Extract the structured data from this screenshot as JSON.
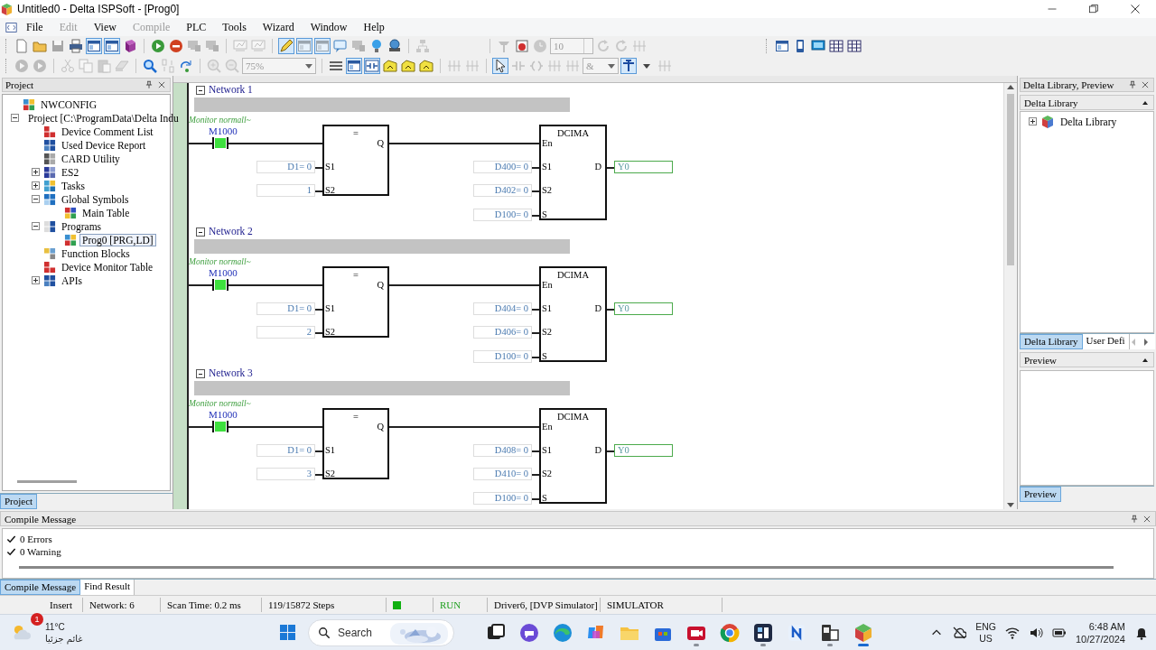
{
  "window": {
    "title": "Untitled0 - Delta ISPSoft - [Prog0]"
  },
  "menu": [
    {
      "label": "File",
      "disabled": false
    },
    {
      "label": "Edit",
      "disabled": true
    },
    {
      "label": "View",
      "disabled": false
    },
    {
      "label": "Compile",
      "disabled": true
    },
    {
      "label": "PLC",
      "disabled": false
    },
    {
      "label": "Tools",
      "disabled": false
    },
    {
      "label": "Wizard",
      "disabled": false
    },
    {
      "label": "Window",
      "disabled": false
    },
    {
      "label": "Help",
      "disabled": false
    }
  ],
  "toolbar_rows": [
    [
      {
        "items": [
          {
            "kind": "button",
            "disabled": false,
            "pressed": false
          },
          {
            "kind": "button",
            "disabled": false,
            "pressed": false
          },
          {
            "kind": "button",
            "disabled": true,
            "pressed": false
          },
          {
            "kind": "button",
            "disabled": false,
            "pressed": false
          },
          {
            "kind": "button",
            "disabled": false,
            "pressed": true
          },
          {
            "kind": "button",
            "disabled": false,
            "pressed": true
          },
          {
            "kind": "button",
            "disabled": false,
            "pressed": false
          },
          {
            "kind": "separator"
          },
          {
            "kind": "button",
            "disabled": false,
            "pressed": false
          },
          {
            "kind": "button",
            "disabled": false,
            "pressed": false
          },
          {
            "kind": "button",
            "disabled": true,
            "pressed": false
          },
          {
            "kind": "button",
            "disabled": true,
            "pressed": false
          },
          {
            "kind": "separator"
          },
          {
            "kind": "button",
            "disabled": true,
            "pressed": false
          },
          {
            "kind": "button",
            "disabled": true,
            "pressed": false
          },
          {
            "kind": "separator"
          },
          {
            "kind": "button",
            "disabled": false,
            "pressed": true
          },
          {
            "kind": "button",
            "disabled": true,
            "pressed": true
          },
          {
            "kind": "button",
            "disabled": true,
            "pressed": true
          },
          {
            "kind": "button",
            "disabled": false,
            "pressed": false
          },
          {
            "kind": "button",
            "disabled": true,
            "pressed": false
          },
          {
            "kind": "button",
            "disabled": false,
            "pressed": false
          },
          {
            "kind": "button",
            "disabled": false,
            "pressed": false
          },
          {
            "kind": "separator"
          },
          {
            "kind": "button",
            "disabled": true,
            "pressed": false
          }
        ]
      },
      {
        "items": [
          {
            "kind": "separator"
          },
          {
            "kind": "button",
            "disabled": true,
            "pressed": false
          },
          {
            "kind": "button",
            "disabled": false,
            "pressed": false
          },
          {
            "kind": "button",
            "disabled": true,
            "pressed": false
          },
          {
            "kind": "spin",
            "value": "10",
            "disabled": true
          },
          {
            "kind": "button",
            "disabled": true,
            "pressed": false
          },
          {
            "kind": "button",
            "disabled": true,
            "pressed": false
          },
          {
            "kind": "button",
            "disabled": true,
            "pressed": false
          }
        ]
      },
      {
        "items": [
          {
            "kind": "button",
            "disabled": false,
            "pressed": false
          },
          {
            "kind": "button",
            "disabled": false,
            "pressed": false
          },
          {
            "kind": "button",
            "disabled": false,
            "pressed": false
          },
          {
            "kind": "button",
            "disabled": false,
            "pressed": false
          },
          {
            "kind": "button",
            "disabled": false,
            "pressed": false
          }
        ]
      }
    ],
    [
      {
        "items": [
          {
            "kind": "button",
            "disabled": true,
            "pressed": false
          },
          {
            "kind": "button",
            "disabled": true,
            "pressed": false
          },
          {
            "kind": "separator"
          },
          {
            "kind": "button",
            "disabled": true,
            "pressed": false
          },
          {
            "kind": "button",
            "disabled": true,
            "pressed": false
          },
          {
            "kind": "button",
            "disabled": true,
            "pressed": false
          },
          {
            "kind": "button",
            "disabled": true,
            "pressed": false
          },
          {
            "kind": "separator"
          },
          {
            "kind": "button",
            "disabled": false,
            "pressed": false
          },
          {
            "kind": "button",
            "disabled": true,
            "pressed": false
          },
          {
            "kind": "button",
            "disabled": false,
            "pressed": false
          },
          {
            "kind": "separator"
          },
          {
            "kind": "button",
            "disabled": true,
            "pressed": false
          },
          {
            "kind": "button",
            "disabled": true,
            "pressed": false
          },
          {
            "kind": "combo",
            "value": "75%",
            "disabled": true
          },
          {
            "kind": "separator"
          },
          {
            "kind": "button",
            "disabled": false,
            "pressed": false
          },
          {
            "kind": "button",
            "disabled": false,
            "pressed": true
          },
          {
            "kind": "button",
            "disabled": false,
            "pressed": true
          },
          {
            "kind": "button",
            "disabled": false,
            "pressed": false
          },
          {
            "kind": "button",
            "disabled": false,
            "pressed": false
          },
          {
            "kind": "button",
            "disabled": false,
            "pressed": false
          },
          {
            "kind": "separator"
          },
          {
            "kind": "button",
            "disabled": true,
            "pressed": false
          },
          {
            "kind": "button",
            "disabled": true,
            "pressed": false
          },
          {
            "kind": "separator"
          },
          {
            "kind": "button",
            "disabled": false,
            "pressed": true
          },
          {
            "kind": "button",
            "disabled": true,
            "pressed": false
          },
          {
            "kind": "button",
            "disabled": true,
            "pressed": false
          },
          {
            "kind": "button",
            "disabled": true,
            "pressed": false
          },
          {
            "kind": "button",
            "disabled": true,
            "pressed": false
          },
          {
            "kind": "combo",
            "value": "&",
            "disabled": true
          },
          {
            "kind": "button",
            "disabled": false,
            "pressed": true
          },
          {
            "kind": "button",
            "disabled": false,
            "pressed": false
          },
          {
            "kind": "button",
            "disabled": true,
            "pressed": false
          }
        ]
      }
    ]
  ],
  "project": {
    "title": "Project",
    "tree": [
      {
        "label": "NWCONFIG",
        "selected": false
      },
      {
        "label": "Project [C:\\ProgramData\\Delta Indu",
        "selected": false,
        "expanded": true,
        "children": [
          {
            "label": "Device Comment List",
            "selected": false
          },
          {
            "label": "Used Device Report",
            "selected": false
          },
          {
            "label": "CARD Utility",
            "selected": false
          },
          {
            "label": "ES2",
            "selected": false,
            "expanded": false
          },
          {
            "label": "Tasks",
            "selected": false,
            "expanded": false
          },
          {
            "label": "Global Symbols",
            "selected": false,
            "expanded": true,
            "children": [
              {
                "label": "Main Table",
                "selected": false
              }
            ]
          },
          {
            "label": "Programs",
            "selected": false,
            "expanded": true,
            "children": [
              {
                "label": "Prog0 [PRG,LD]",
                "selected": true
              }
            ]
          },
          {
            "label": "Function Blocks",
            "selected": false
          },
          {
            "label": "Device Monitor Table",
            "selected": false
          },
          {
            "label": "APIs",
            "selected": false,
            "expanded": false
          }
        ]
      }
    ],
    "tabs": [
      {
        "label": "Project",
        "selected": true
      }
    ]
  },
  "networks": [
    {
      "title": "Network 1",
      "contact": {
        "comment": "Monitor normall~",
        "label": "M1000",
        "on": true
      },
      "compare": {
        "operator": "=",
        "output": "Q",
        "inputs": [
          {
            "pin": "S1",
            "value": "D1= 0"
          },
          {
            "pin": "S2",
            "value": "1"
          }
        ]
      },
      "instruction": {
        "name": "DCIMA",
        "enable": "En",
        "inputs": [
          {
            "pin": "S1",
            "value": "D400= 0"
          },
          {
            "pin": "S2",
            "value": "D402= 0"
          },
          {
            "pin": "S",
            "value": "D100= 0"
          }
        ],
        "output_pin": "D",
        "output": "Y0"
      }
    },
    {
      "title": "Network 2",
      "contact": {
        "comment": "Monitor normall~",
        "label": "M1000",
        "on": true
      },
      "compare": {
        "operator": "=",
        "output": "Q",
        "inputs": [
          {
            "pin": "S1",
            "value": "D1= 0"
          },
          {
            "pin": "S2",
            "value": "2"
          }
        ]
      },
      "instruction": {
        "name": "DCIMA",
        "enable": "En",
        "inputs": [
          {
            "pin": "S1",
            "value": "D404= 0"
          },
          {
            "pin": "S2",
            "value": "D406= 0"
          },
          {
            "pin": "S",
            "value": "D100= 0"
          }
        ],
        "output_pin": "D",
        "output": "Y0"
      }
    },
    {
      "title": "Network 3",
      "contact": {
        "comment": "Monitor normall~",
        "label": "M1000",
        "on": true
      },
      "compare": {
        "operator": "=",
        "output": "Q",
        "inputs": [
          {
            "pin": "S1",
            "value": "D1= 0"
          },
          {
            "pin": "S2",
            "value": "3"
          }
        ]
      },
      "instruction": {
        "name": "DCIMA",
        "enable": "En",
        "inputs": [
          {
            "pin": "S1",
            "value": "D408= 0"
          },
          {
            "pin": "S2",
            "value": "D410= 0"
          },
          {
            "pin": "S",
            "value": "D100= 0"
          }
        ],
        "output_pin": "D",
        "output": "Y0"
      }
    }
  ],
  "library": {
    "title": "Delta Library, Preview",
    "header": "Delta Library",
    "tree": [
      {
        "label": "Delta Library",
        "selected": false,
        "expanded": false
      }
    ],
    "tabs": [
      {
        "label": "Delta Library",
        "selected": true
      },
      {
        "label": "User Defi",
        "selected": false
      }
    ],
    "preview_header": "Preview",
    "preview_tabs": [
      {
        "label": "Preview",
        "selected": true
      }
    ]
  },
  "compile": {
    "title": "Compile Message",
    "messages": [
      {
        "kind": "ok",
        "text": "0 Errors"
      },
      {
        "kind": "ok",
        "text": "0 Warning"
      }
    ],
    "tabs": [
      {
        "label": "Compile Message",
        "selected": true
      },
      {
        "label": "Find Result",
        "selected": false
      }
    ]
  },
  "status_bar": [
    {
      "kind": "text",
      "text": "Insert"
    },
    {
      "kind": "text",
      "text": "Network: 6"
    },
    {
      "kind": "text",
      "text": "Scan Time: 0.2 ms"
    },
    {
      "kind": "text",
      "text": "119/15872 Steps"
    },
    {
      "kind": "led",
      "color": "#10b010"
    },
    {
      "kind": "text",
      "text": "RUN",
      "color": "#20a020"
    },
    {
      "kind": "text",
      "text": "Driver6, [DVP Simulator]"
    },
    {
      "kind": "text",
      "text": "SIMULATOR"
    }
  ],
  "taskbar": {
    "weather": {
      "temperature": "11°C",
      "condition": "غائم جزئيا",
      "badge": "1"
    },
    "search": {
      "placeholder": "Search"
    },
    "apps": [
      {
        "running": false,
        "active": false
      },
      {
        "running": false,
        "active": false
      },
      {
        "running": false,
        "active": false
      },
      {
        "running": false,
        "active": false
      },
      {
        "running": false,
        "active": false
      },
      {
        "running": false,
        "active": false
      },
      {
        "running": true,
        "active": false
      },
      {
        "running": false,
        "active": false
      },
      {
        "running": true,
        "active": false
      },
      {
        "running": false,
        "active": false
      },
      {
        "running": true,
        "active": false
      },
      {
        "running": true,
        "active": true
      }
    ],
    "tray": {
      "language": "ENG",
      "region": "US",
      "time": "6:48 AM",
      "date": "10/27/2024"
    }
  }
}
